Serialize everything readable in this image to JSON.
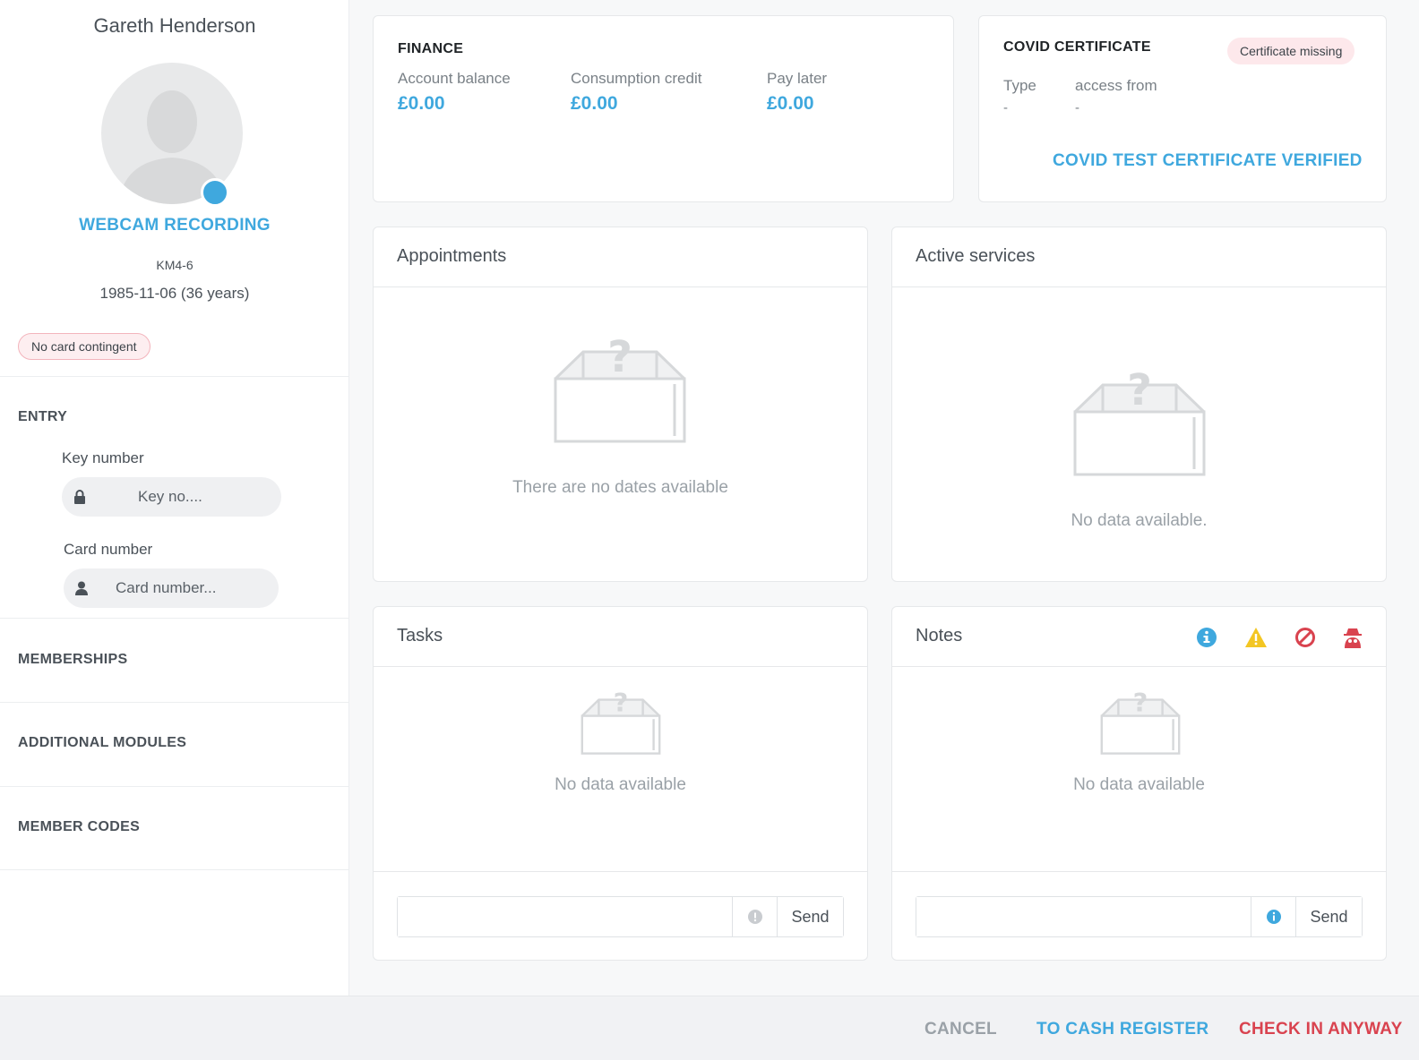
{
  "profile": {
    "name": "Gareth Henderson",
    "webcam_label": "WEBCAM RECORDING",
    "member_id": "KM4-6",
    "birth": "1985-11-06 (36 years)",
    "card_badge": "No card contingent"
  },
  "entry": {
    "title": "ENTRY",
    "key_label": "Key number",
    "key_placeholder": "Key no....",
    "card_label": "Card number",
    "card_placeholder": "Card number..."
  },
  "sections": {
    "memberships": "MEMBERSHIPS",
    "additional_modules": "ADDITIONAL MODULES",
    "member_codes": "MEMBER CODES"
  },
  "finance": {
    "title": "FINANCE",
    "items": [
      {
        "label": "Account balance",
        "value": "£0.00"
      },
      {
        "label": "Consumption credit",
        "value": "£0.00"
      },
      {
        "label": "Pay later",
        "value": "£0.00"
      }
    ]
  },
  "covid": {
    "title": "COVID CERTIFICATE",
    "badge": "Certificate missing",
    "type_label": "Type",
    "type_value": "-",
    "access_label": "access from",
    "access_value": "-",
    "verified_link": "COVID TEST CERTIFICATE VERIFIED"
  },
  "appointments": {
    "title": "Appointments",
    "empty": "There are no dates available"
  },
  "active_services": {
    "title": "Active services",
    "empty": "No data available."
  },
  "tasks": {
    "title": "Tasks",
    "empty": "No data available",
    "send_label": "Send"
  },
  "notes": {
    "title": "Notes",
    "empty": "No data available",
    "send_label": "Send"
  },
  "actions": {
    "cancel": "CANCEL",
    "cash_register": "TO CASH REGISTER",
    "check_in": "CHECK IN ANYWAY"
  },
  "colors": {
    "accent": "#3fa8de",
    "danger": "#d9434f",
    "warning": "#f3c623"
  },
  "icons": [
    "person-silhouette-icon",
    "lock-icon",
    "user-icon",
    "empty-box-icon",
    "info-icon",
    "warning-icon",
    "block-icon",
    "spy-icon"
  ]
}
